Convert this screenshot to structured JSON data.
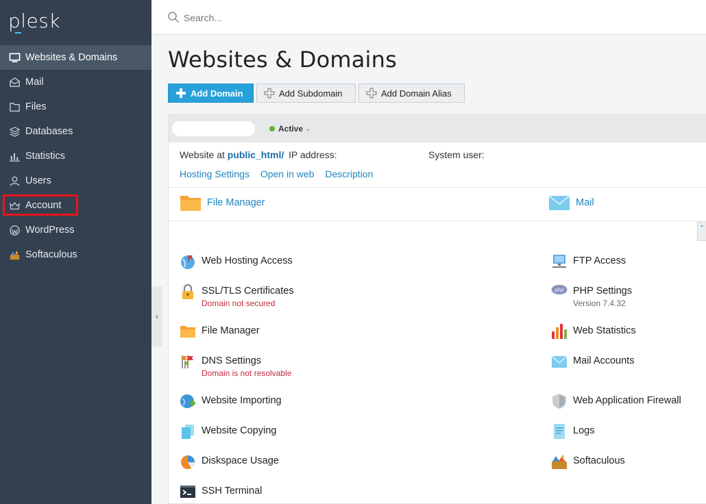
{
  "app": {
    "logo": "plesk"
  },
  "sidebar": {
    "items": [
      {
        "label": "Websites & Domains",
        "icon": "monitor-icon",
        "active": true
      },
      {
        "label": "Mail",
        "icon": "envelope-icon"
      },
      {
        "label": "Files",
        "icon": "folder-icon"
      },
      {
        "label": "Databases",
        "icon": "database-icon"
      },
      {
        "label": "Statistics",
        "icon": "bar-chart-icon"
      },
      {
        "label": "Users",
        "icon": "user-icon"
      },
      {
        "label": "Account",
        "icon": "crown-icon",
        "highlighted": true
      },
      {
        "label": "WordPress",
        "icon": "wordpress-icon"
      },
      {
        "label": "Softaculous",
        "icon": "softaculous-icon"
      }
    ],
    "highlight_color": "#e8141c"
  },
  "search": {
    "placeholder": "Search..."
  },
  "page": {
    "title": "Websites & Domains"
  },
  "toolbar": {
    "add_domain": "Add Domain",
    "add_subdomain": "Add Subdomain",
    "add_domain_alias": "Add Domain Alias"
  },
  "domain": {
    "name": "",
    "status": "Active",
    "website_at_label": "Website at",
    "website_path": "public_html/",
    "ip_label": "IP address:",
    "system_user_label": "System user:",
    "links": [
      "Hosting Settings",
      "Open in web",
      "Description"
    ]
  },
  "quick_links": {
    "file_manager": "File Manager",
    "mail": "Mail"
  },
  "tools": {
    "left": [
      {
        "label": "Web Hosting Access",
        "icon": "globe-flag-icon"
      },
      {
        "label": "SSL/TLS Certificates",
        "icon": "lock-icon",
        "sub": "Domain not secured",
        "sub_type": "err"
      },
      {
        "label": "File Manager",
        "icon": "folder-icon"
      },
      {
        "label": "DNS Settings",
        "icon": "dns-flags-icon",
        "sub": "Domain is not resolvable",
        "sub_type": "err"
      },
      {
        "label": "Website Importing",
        "icon": "globe-import-icon"
      },
      {
        "label": "Website Copying",
        "icon": "copy-icon"
      },
      {
        "label": "Diskspace Usage",
        "icon": "pie-icon"
      },
      {
        "label": "SSH Terminal",
        "icon": "terminal-icon"
      }
    ],
    "right": [
      {
        "label": "FTP Access",
        "icon": "ftp-icon"
      },
      {
        "label": "PHP Settings",
        "icon": "php-icon",
        "sub": "Version 7.4.32",
        "sub_type": "muted"
      },
      {
        "label": "Web Statistics",
        "icon": "stats-icon"
      },
      {
        "label": "Mail Accounts",
        "icon": "envelope-icon"
      },
      {
        "label": "Web Application Firewall",
        "icon": "shield-icon"
      },
      {
        "label": "Logs",
        "icon": "logs-icon"
      },
      {
        "label": "Softaculous",
        "icon": "softaculous-icon"
      }
    ]
  },
  "colors": {
    "sidebar_bg": "#34404f",
    "sidebar_active": "#4a5767",
    "primary": "#28a1db",
    "link": "#1d86bf",
    "error": "#c5283d",
    "status_ok": "#65b32e"
  }
}
